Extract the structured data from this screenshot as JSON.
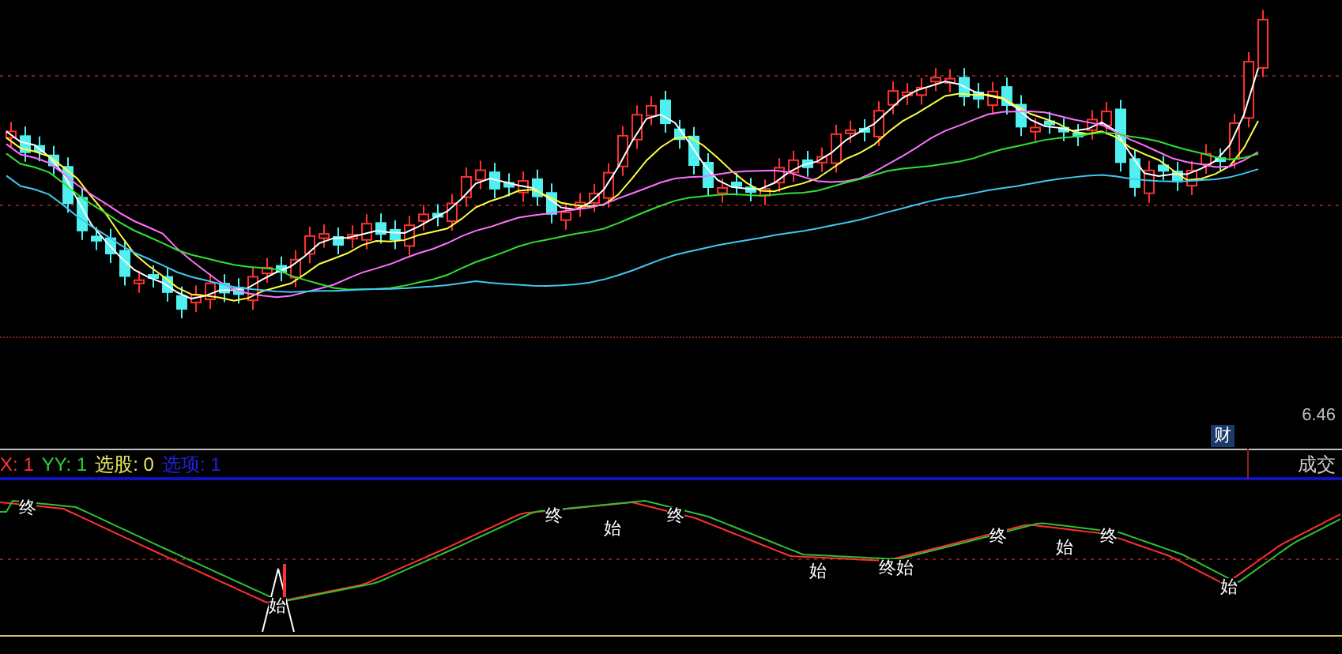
{
  "price_panel": {
    "price_label": "6.46",
    "badge": "财"
  },
  "indicator_legend": [
    {
      "label": "X:",
      "value": "1",
      "color": "#ff3030"
    },
    {
      "label": "YY:",
      "value": "1",
      "color": "#30d030"
    },
    {
      "label": "选股:",
      "value": "0",
      "color": "#e8e860"
    },
    {
      "label": "选项:",
      "value": "1",
      "color": "#2020e0"
    }
  ],
  "volume_tab": "成交",
  "signals": [
    {
      "text": "终"
    },
    {
      "text": "始"
    },
    {
      "text": "终"
    },
    {
      "text": "始"
    },
    {
      "text": "终"
    },
    {
      "text": "始"
    },
    {
      "text": "终始"
    },
    {
      "text": "终"
    },
    {
      "text": "始"
    },
    {
      "text": "终"
    },
    {
      "text": "始"
    }
  ]
}
